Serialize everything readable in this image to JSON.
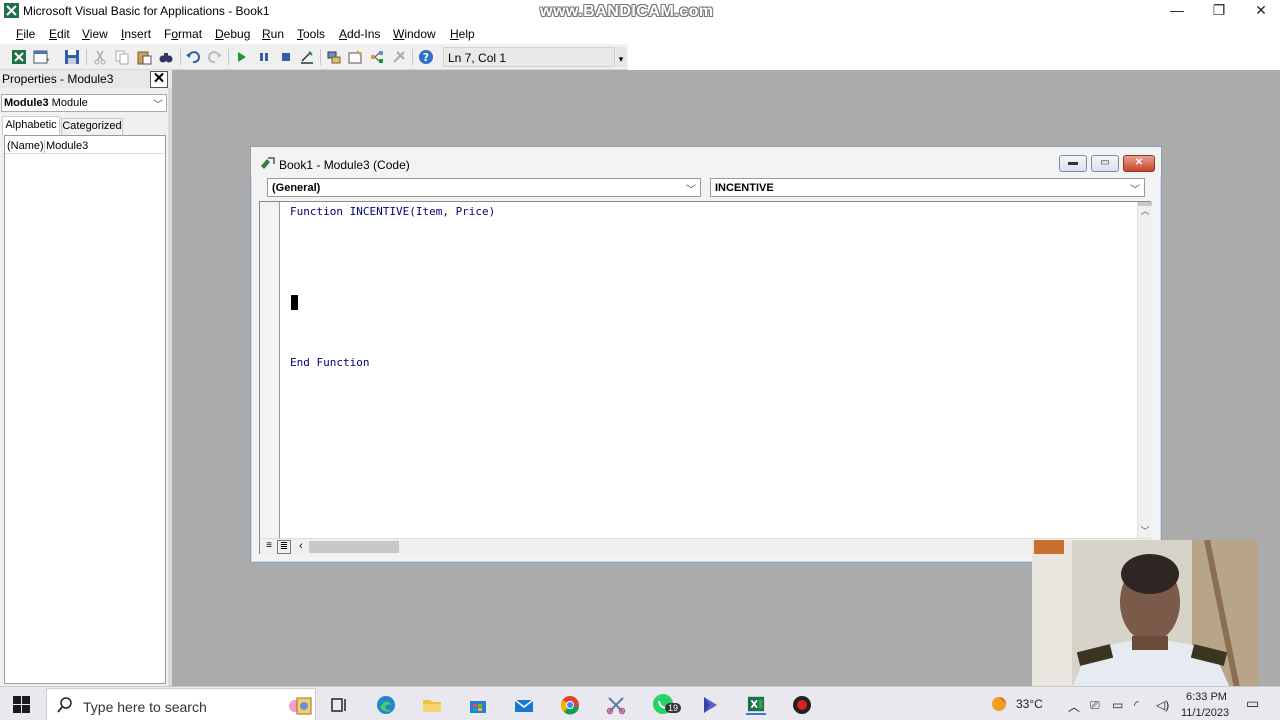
{
  "window": {
    "title": "Microsoft Visual Basic for Applications - Book1",
    "watermark": "www.BANDICAM.com",
    "minimize_label": "—",
    "restore_label": "❐",
    "close_label": "✕"
  },
  "menu": {
    "items": [
      {
        "mn": "F",
        "rest": "ile"
      },
      {
        "mn": "E",
        "rest": "dit"
      },
      {
        "mn": "V",
        "rest": "iew"
      },
      {
        "mn": "I",
        "rest": "nsert"
      },
      {
        "mn": "",
        "rest": "Format",
        "pre": "F",
        "post": "ormat"
      },
      {
        "mn": "D",
        "rest": "ebug"
      },
      {
        "mn": "R",
        "rest": "un"
      },
      {
        "mn": "T",
        "rest": "ools"
      },
      {
        "mn": "",
        "rest": "Add-Ins"
      },
      {
        "mn": "W",
        "rest": "indow"
      },
      {
        "mn": "H",
        "rest": "elp"
      }
    ]
  },
  "toolbar": {
    "cursor_position": "Ln 7, Col 1",
    "overflow_label": "▾"
  },
  "properties": {
    "title": "Properties - Module3",
    "close_label": "✕",
    "object_name": "Module3",
    "object_type": " Module",
    "tabs": [
      "Alphabetic",
      "Categorized"
    ],
    "rows": [
      {
        "name": "(Name)",
        "value": "Module3"
      }
    ]
  },
  "code_window": {
    "title": "Book1 - Module3 (Code)",
    "object_combo": "(General)",
    "procedure_combo": "INCENTIVE",
    "lines": [
      "Function INCENTIVE(Item, Price)",
      "End Function"
    ]
  },
  "taskbar": {
    "search_placeholder": "Type here to search",
    "weather_temp": "33°C",
    "time": "6:33 PM",
    "date": "11/1/2023",
    "whatsapp_badge": "19"
  },
  "colors": {
    "code_keyword": "#00007f",
    "excel_green": "#1e7145",
    "accent": "#3b78d6"
  }
}
